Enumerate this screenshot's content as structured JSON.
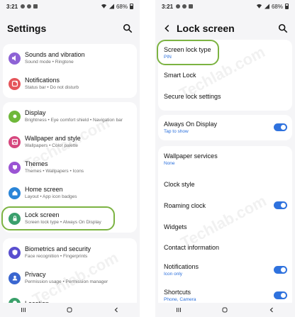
{
  "left": {
    "status": {
      "time": "3:21",
      "battery": "68%"
    },
    "title": "Settings",
    "items": [
      {
        "title": "Sounds and vibration",
        "sub": "Sound mode  •  Ringtone",
        "icon": "speaker-icon",
        "color": "#8e63d6"
      },
      {
        "title": "Notifications",
        "sub": "Status bar  •  Do not disturb",
        "icon": "notification-icon",
        "color": "#e5555a"
      },
      {
        "title": "Display",
        "sub": "Brightness  •  Eye comfort shield  •  Navigation bar",
        "icon": "brightness-icon",
        "color": "#6fb83a"
      },
      {
        "title": "Wallpaper and style",
        "sub": "Wallpapers  •  Color palette",
        "icon": "wallpaper-icon",
        "color": "#d6477e"
      },
      {
        "title": "Themes",
        "sub": "Themes  •  Wallpapers  •  Icons",
        "icon": "themes-icon",
        "color": "#9b54d4"
      },
      {
        "title": "Home screen",
        "sub": "Layout  •  App icon badges",
        "icon": "home-icon",
        "color": "#2a85d8"
      },
      {
        "title": "Lock screen",
        "sub": "Screen lock type  •  Always On Display",
        "icon": "lock-icon",
        "color": "#3a9f6c"
      },
      {
        "title": "Biometrics and security",
        "sub": "Face recognition  •  Fingerprints",
        "icon": "shield-icon",
        "color": "#5a4fcf"
      },
      {
        "title": "Privacy",
        "sub": "Permission usage  •  Permission manager",
        "icon": "privacy-icon",
        "color": "#3a66d0"
      },
      {
        "title": "Location",
        "sub": "",
        "icon": "location-icon",
        "color": "#3aa06a"
      }
    ]
  },
  "right": {
    "status": {
      "time": "3:21",
      "battery": "68%"
    },
    "title": "Lock screen",
    "items": [
      {
        "title": "Screen lock type",
        "sub": "PIN",
        "toggle": false
      },
      {
        "title": "Smart Lock",
        "sub": "",
        "toggle": false
      },
      {
        "title": "Secure lock settings",
        "sub": "",
        "toggle": false
      },
      {
        "title": "Always On Display",
        "sub": "Tap to show",
        "toggle": true
      },
      {
        "title": "Wallpaper services",
        "sub": "None",
        "toggle": false
      },
      {
        "title": "Clock style",
        "sub": "",
        "toggle": false
      },
      {
        "title": "Roaming clock",
        "sub": "",
        "toggle": true
      },
      {
        "title": "Widgets",
        "sub": "",
        "toggle": false
      },
      {
        "title": "Contact information",
        "sub": "",
        "toggle": false
      },
      {
        "title": "Notifications",
        "sub": "Icon only",
        "toggle": true
      },
      {
        "title": "Shortcuts",
        "sub": "Phone, Camera",
        "toggle": true
      }
    ]
  },
  "watermark": "Techlab.com",
  "colors": {
    "accent": "#2f72de",
    "highlight": "#7cb342"
  }
}
